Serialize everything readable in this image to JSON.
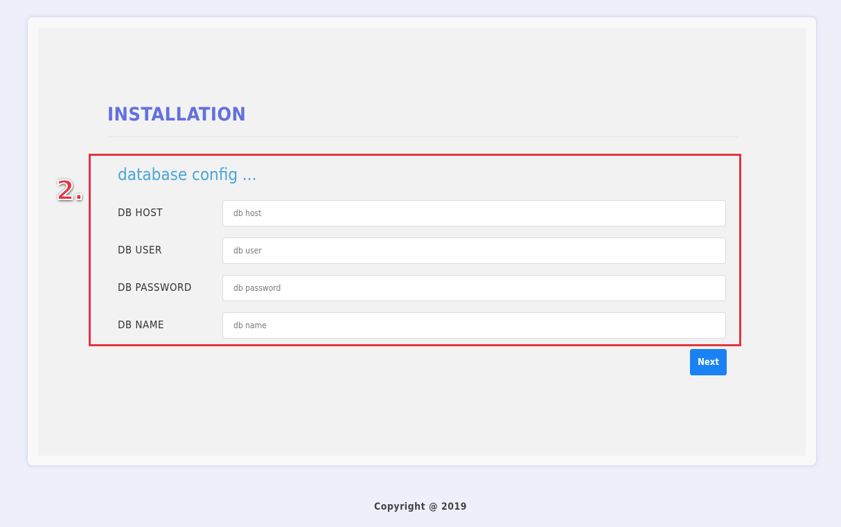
{
  "page": {
    "title": "INSTALLATION",
    "step_badge": "2."
  },
  "database_config": {
    "heading": "database config ...",
    "fields": [
      {
        "label": "DB HOST",
        "placeholder": "db host",
        "value": ""
      },
      {
        "label": "DB USER",
        "placeholder": "db user",
        "value": ""
      },
      {
        "label": "DB PASSWORD",
        "placeholder": "db password",
        "value": ""
      },
      {
        "label": "DB NAME",
        "placeholder": "db name",
        "value": ""
      }
    ]
  },
  "actions": {
    "next_label": "Next"
  },
  "footer": {
    "copyright": "Copyright @ 2019"
  },
  "colors": {
    "background": "#edf0fb",
    "title": "#6270e0",
    "section_heading": "#4aa6d8",
    "highlight": "#e3343f",
    "primary_button": "#1a82f2"
  }
}
